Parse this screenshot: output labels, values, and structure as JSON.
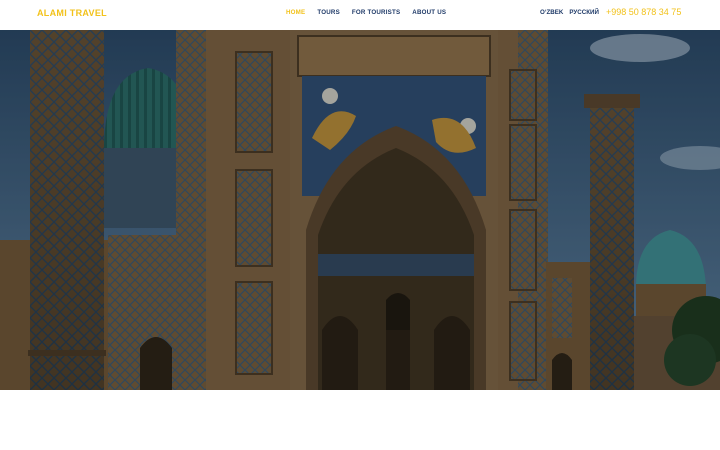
{
  "header": {
    "logo": "ALAMI TRAVEL",
    "nav": [
      {
        "label": "HOME",
        "active": true
      },
      {
        "label": "TOURS",
        "active": false
      },
      {
        "label": "FOR TOURISTS",
        "active": false
      },
      {
        "label": "ABOUT US",
        "active": false
      }
    ],
    "languages": [
      "O‘ZBEK",
      "РУССКИЙ"
    ],
    "phone": "+998 50 878 34 75"
  },
  "colors": {
    "accent": "#f2c21b",
    "nav_text": "#1f3a68",
    "sky": "#2d4b6a",
    "tile_blue": "#2f5f8a",
    "dome_teal": "#2f6e6a"
  },
  "hero": {
    "image": "registan-madrasa-photo"
  }
}
